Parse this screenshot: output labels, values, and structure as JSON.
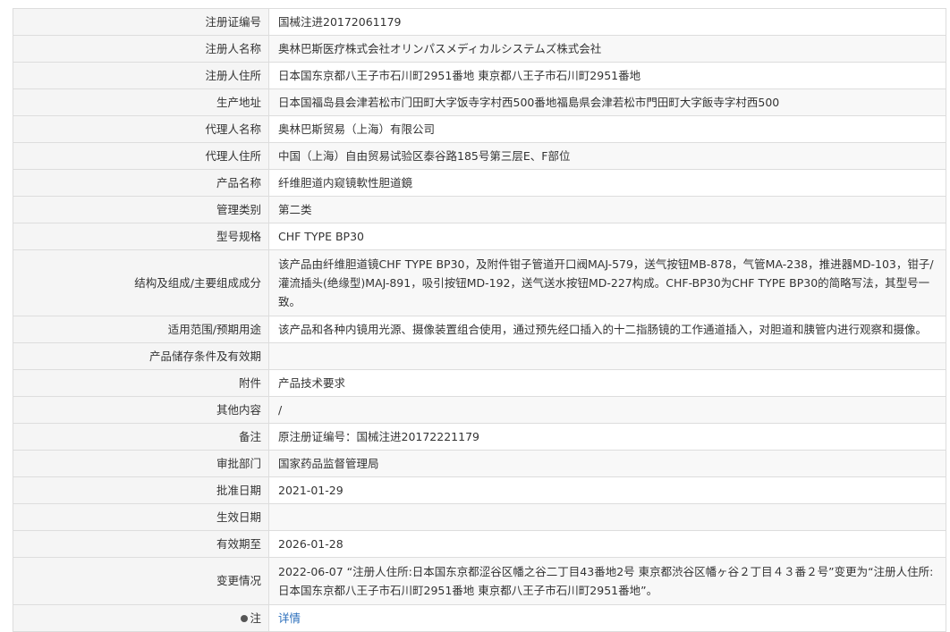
{
  "rows": [
    {
      "label": "注册证编号",
      "value": "国械注进20172061179"
    },
    {
      "label": "注册人名称",
      "value": "奥林巴斯医疗株式会社オリンパスメディカルシステムズ株式会社"
    },
    {
      "label": "注册人住所",
      "value": "日本国东京都八王子市石川町2951番地 東京都八王子市石川町2951番地"
    },
    {
      "label": "生产地址",
      "value": "日本国福岛县会津若松市门田町大字饭寺字村西500番地福島県会津若松市門田町大字飯寺字村西500"
    },
    {
      "label": "代理人名称",
      "value": "奥林巴斯贸易（上海）有限公司"
    },
    {
      "label": "代理人住所",
      "value": "中国（上海）自由贸易试验区泰谷路185号第三层E、F部位"
    },
    {
      "label": "产品名称",
      "value": "纤维胆道内窥镜軟性胆道鏡"
    },
    {
      "label": "管理类别",
      "value": "第二类"
    },
    {
      "label": "型号规格",
      "value": "CHF TYPE BP30"
    },
    {
      "label": "结构及组成/主要组成成分",
      "value": "该产品由纤维胆道镜CHF TYPE BP30，及附件钳子管道开口阀MAJ-579，送气按钮MB-878，气管MA-238，推进器MD-103，钳子/灌流插头(绝缘型)MAJ-891，吸引按钮MD-192，送气送水按钮MD-227构成。CHF-BP30为CHF TYPE BP30的简略写法，其型号一致。"
    },
    {
      "label": "适用范围/预期用途",
      "value": "该产品和各种内镜用光源、摄像装置组合使用，通过预先经口插入的十二指肠镜的工作通道插入，对胆道和胰管内进行观察和摄像。"
    },
    {
      "label": "产品储存条件及有效期",
      "value": ""
    },
    {
      "label": "附件",
      "value": "产品技术要求"
    },
    {
      "label": "其他内容",
      "value": "/"
    },
    {
      "label": "备注",
      "value": "原注册证编号：国械注进20172221179"
    },
    {
      "label": "审批部门",
      "value": "国家药品监督管理局"
    },
    {
      "label": "批准日期",
      "value": "2021-01-29"
    },
    {
      "label": "生效日期",
      "value": ""
    },
    {
      "label": "有效期至",
      "value": "2026-01-28"
    },
    {
      "label": "变更情况",
      "value": "2022-06-07 “注册人住所:日本国东京都涩谷区幡之谷二丁目43番地2号 東京都渋谷区幡ヶ谷２丁目４３番２号”变更为“注册人住所:日本国东京都八王子市石川町2951番地 東京都八王子市石川町2951番地”。"
    },
    {
      "label": "注",
      "value": "详情",
      "icon": "dot-icon"
    }
  ]
}
